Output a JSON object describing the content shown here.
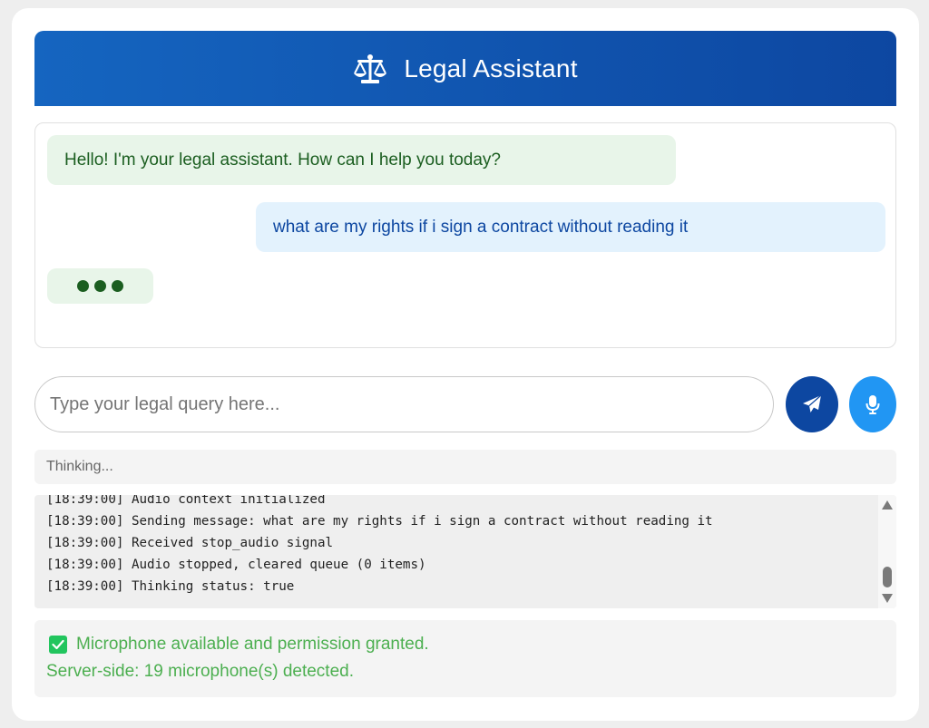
{
  "header": {
    "title": "Legal Assistant",
    "icon": "scale-balance-icon"
  },
  "chat": {
    "messages": [
      {
        "role": "assistant",
        "text": "Hello! I'm your legal assistant. How can I help you today?"
      },
      {
        "role": "user",
        "text": "what are my rights if i sign a contract without reading it"
      }
    ],
    "typing_indicator_visible": true
  },
  "composer": {
    "placeholder": "Type your legal query here...",
    "value": "",
    "send_icon": "paper-plane-icon",
    "mic_icon": "microphone-icon"
  },
  "status": {
    "text": "Thinking..."
  },
  "log": {
    "lines": [
      "[18:39:00] Audio context initialized",
      "[18:39:00] Sending message: what are my rights if i sign a contract without reading it",
      "[18:39:00] Received stop_audio signal",
      "[18:39:00] Audio stopped, cleared queue (0 items)",
      "[18:39:00] Thinking status: true"
    ]
  },
  "mic_status": {
    "line1": "Microphone available and permission granted.",
    "line2": "Server-side: 19 microphone(s) detected.",
    "check_icon": "checkmark-icon"
  },
  "colors": {
    "header_gradient_start": "#1565c0",
    "header_gradient_end": "#0d47a1",
    "assistant_bubble": "#e8f5e9",
    "user_bubble": "#e3f2fd",
    "send_button": "#0d47a1",
    "mic_button": "#2196f3",
    "success_text": "#4caf50"
  }
}
